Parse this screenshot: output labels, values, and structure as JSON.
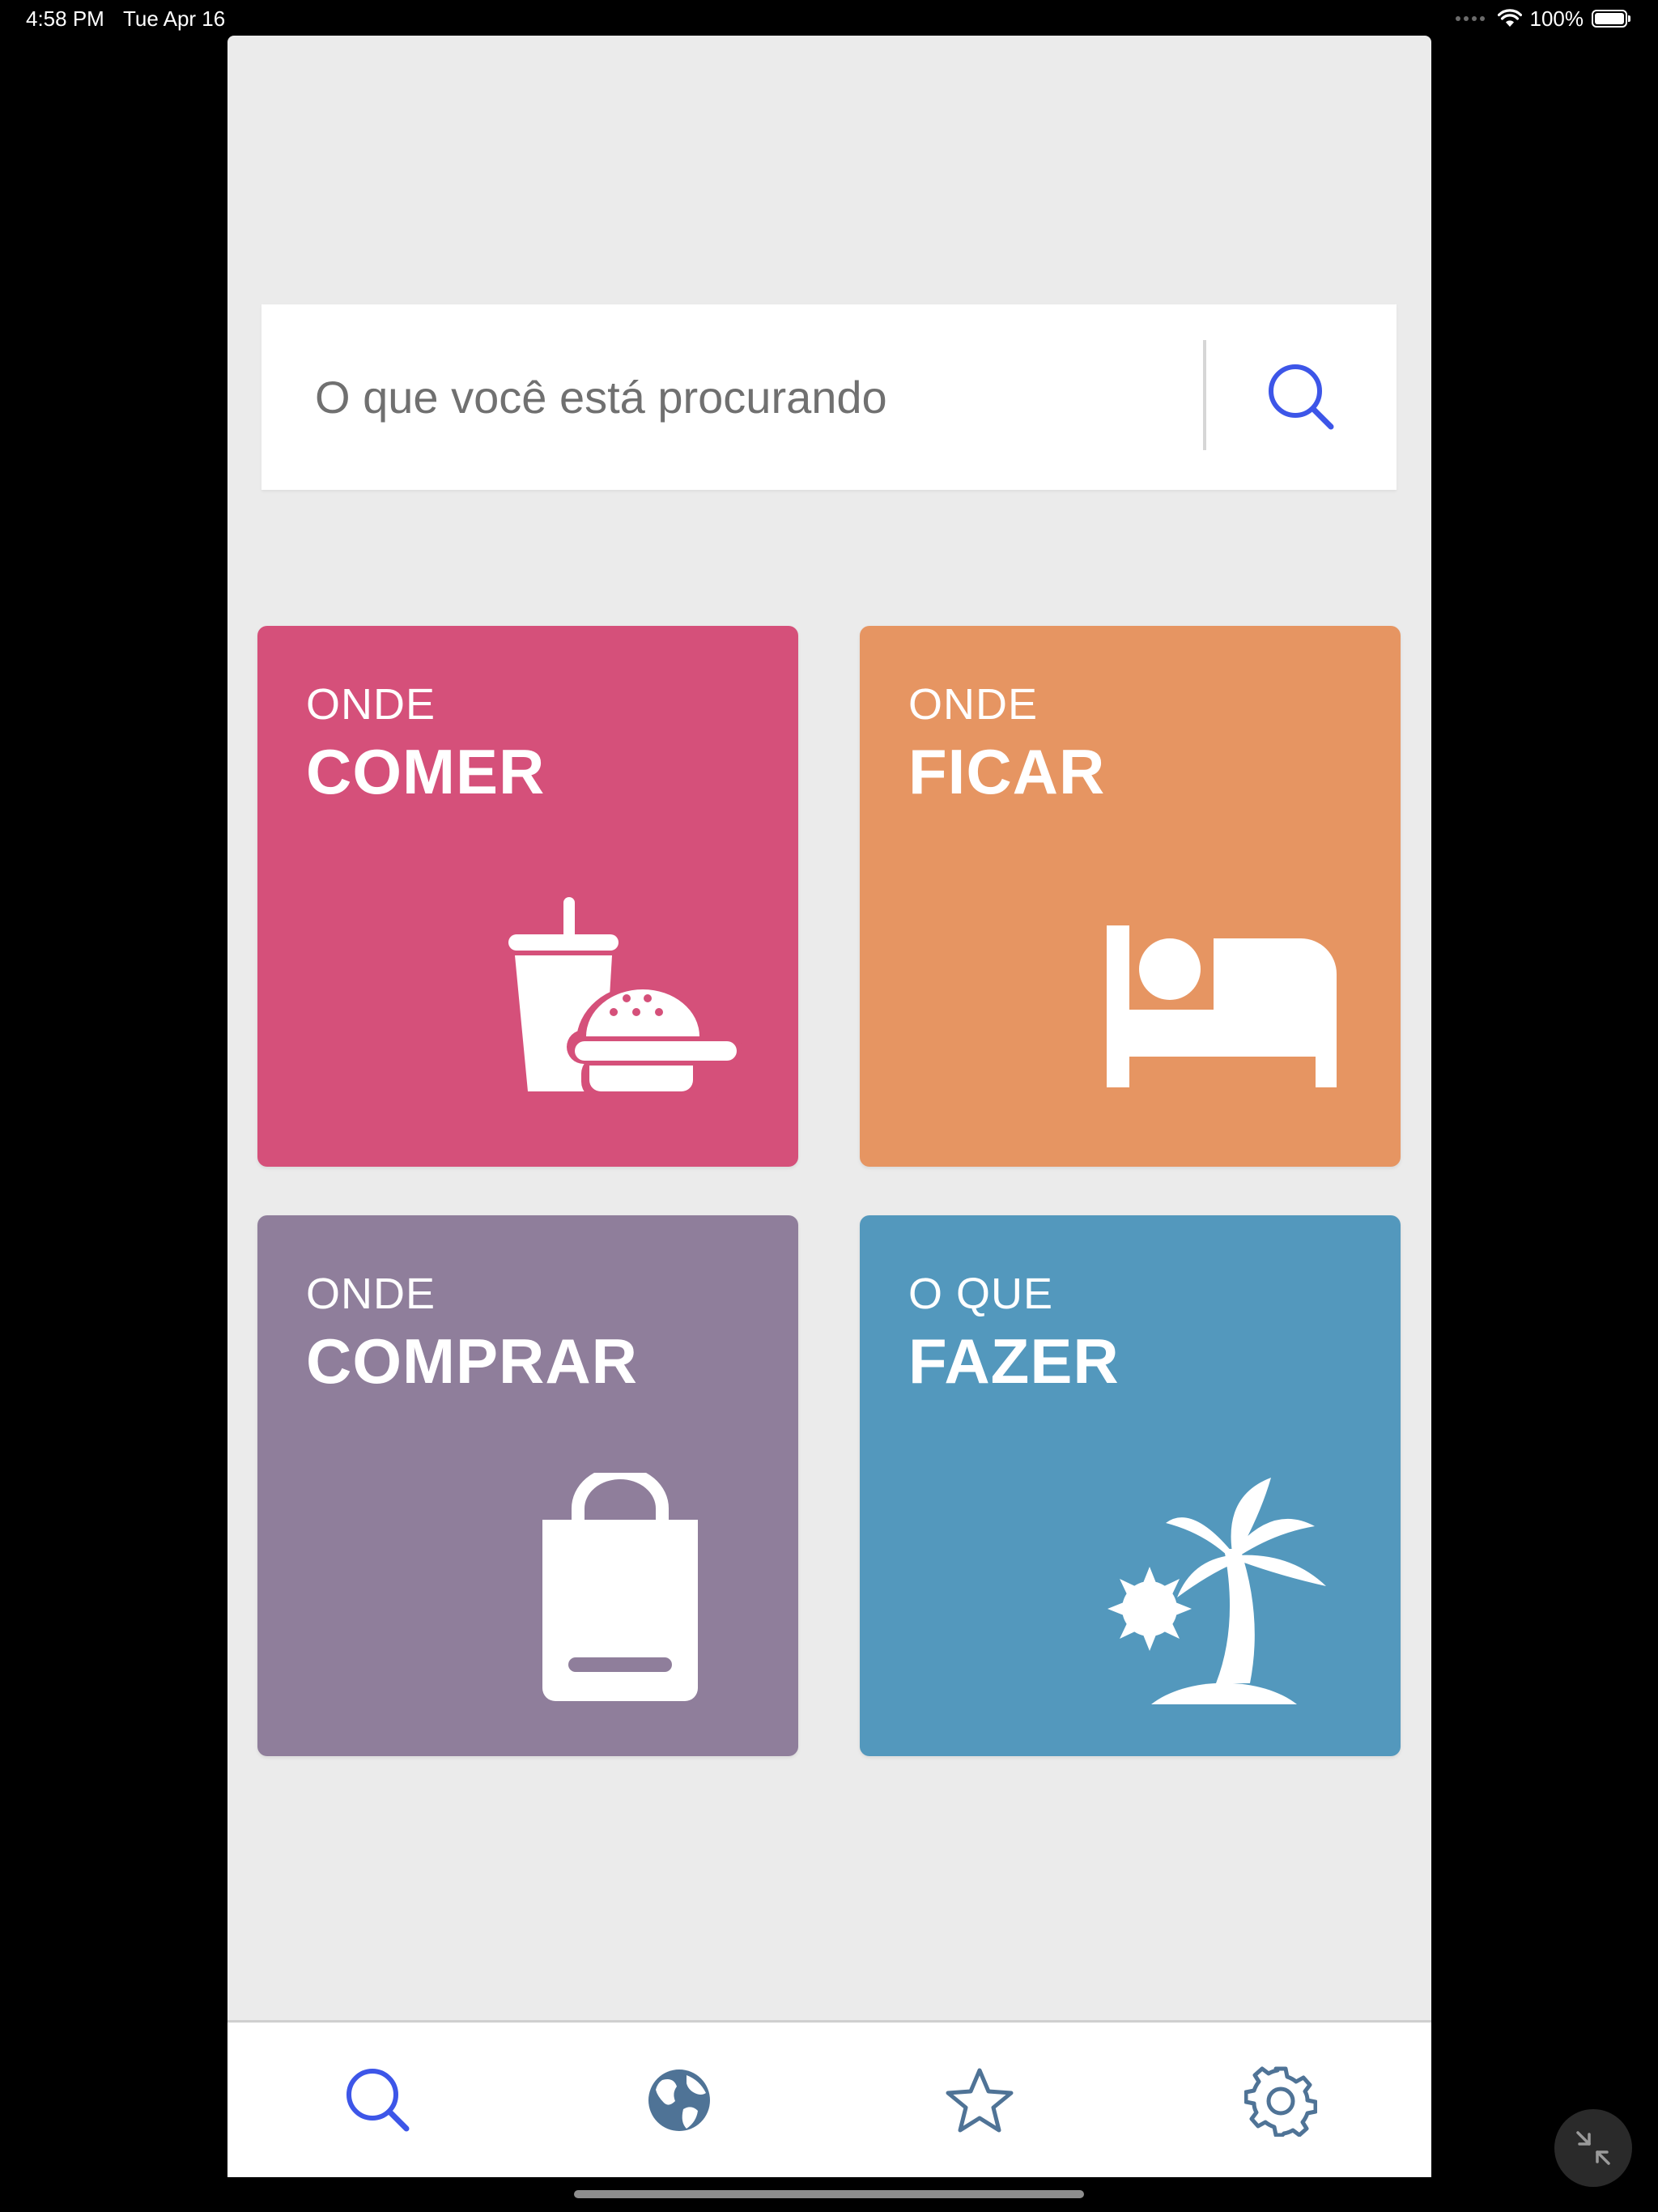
{
  "status_bar": {
    "time": "4:58 PM",
    "date": "Tue Apr 16",
    "battery": "100%"
  },
  "search": {
    "placeholder": "O que você está procurando",
    "value": "",
    "icon": "search-icon",
    "accent_color": "#3d56e8"
  },
  "tiles": [
    {
      "kicker": "ONDE",
      "title": "COMER",
      "icon": "food-drink-icon",
      "color": "#d5507a"
    },
    {
      "kicker": "ONDE",
      "title": "FICAR",
      "icon": "bed-icon",
      "color": "#e69562"
    },
    {
      "kicker": "ONDE",
      "title": "COMPRAR",
      "icon": "shopping-bag-icon",
      "color": "#8f7e9b"
    },
    {
      "kicker": "O QUE",
      "title": "FAZER",
      "icon": "palm-tree-icon",
      "color": "#5398bd"
    }
  ],
  "tab_bar": {
    "items": [
      {
        "icon": "search-icon",
        "active": true
      },
      {
        "icon": "globe-icon",
        "active": false
      },
      {
        "icon": "star-icon",
        "active": false
      },
      {
        "icon": "gear-icon",
        "active": false
      }
    ],
    "active_color": "#3d56e8",
    "inactive_color": "#4f7396"
  },
  "app_background": "#ebebeb"
}
